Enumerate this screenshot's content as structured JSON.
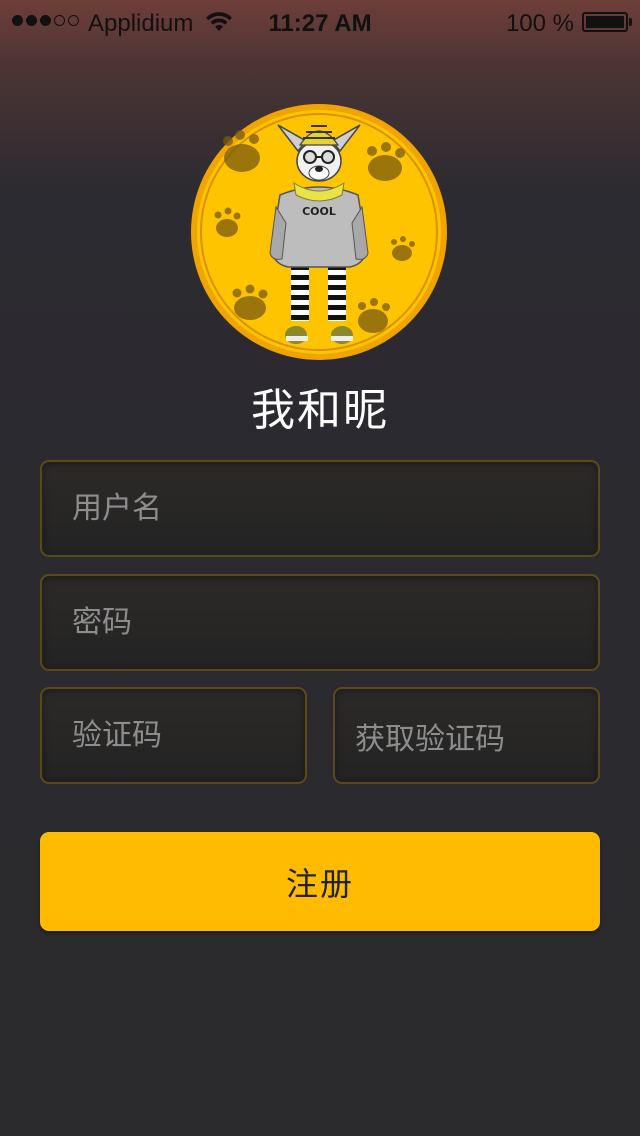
{
  "status_bar": {
    "carrier": "Applidium",
    "time": "11:27 AM",
    "battery_percent": "100 %",
    "signal_bars_filled": 3,
    "signal_bars_total": 5
  },
  "avatar": {
    "icon": "dog-mascot-avatar",
    "shirt_text": "COOL",
    "colors": {
      "badge": "#ffbb00",
      "ring": "#f5a800"
    }
  },
  "app_name": "我和昵",
  "form": {
    "username_placeholder": "用户名",
    "password_placeholder": "密码",
    "code_placeholder": "验证码",
    "get_code_label": "获取验证码",
    "register_label": "注册"
  },
  "colors": {
    "accent": "#ffbb00",
    "field_border": "#5a4a18"
  }
}
